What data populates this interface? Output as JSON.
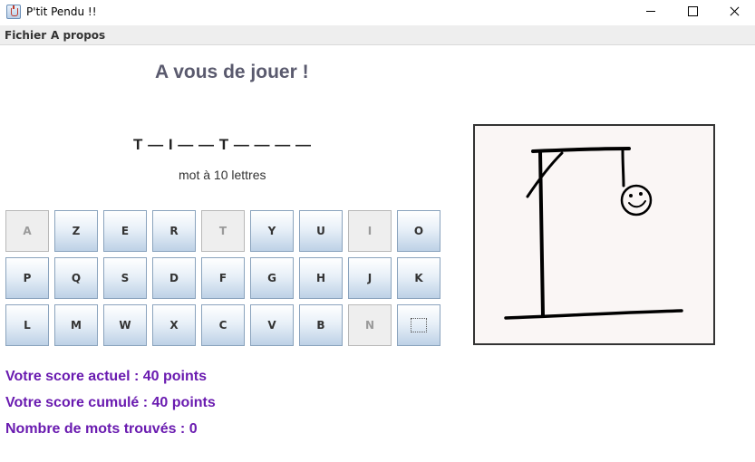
{
  "window": {
    "title": "P'tit Pendu !!",
    "icon": "java-cup-icon"
  },
  "menu": {
    "items": [
      "Fichier",
      "A propos"
    ]
  },
  "game": {
    "heading": "A vous de jouer !",
    "word_display": "T — I — — T — — — —",
    "word_info": "mot à 10 lettres"
  },
  "keyboard": {
    "rows": [
      [
        {
          "label": "A",
          "enabled": false
        },
        {
          "label": "Z",
          "enabled": true
        },
        {
          "label": "E",
          "enabled": true
        },
        {
          "label": "R",
          "enabled": true
        },
        {
          "label": "T",
          "enabled": false
        },
        {
          "label": "Y",
          "enabled": true
        },
        {
          "label": "U",
          "enabled": true
        },
        {
          "label": "I",
          "enabled": false
        },
        {
          "label": "O",
          "enabled": true
        }
      ],
      [
        {
          "label": "P",
          "enabled": true
        },
        {
          "label": "Q",
          "enabled": true
        },
        {
          "label": "S",
          "enabled": true
        },
        {
          "label": "D",
          "enabled": true
        },
        {
          "label": "F",
          "enabled": true
        },
        {
          "label": "G",
          "enabled": true
        },
        {
          "label": "H",
          "enabled": true
        },
        {
          "label": "J",
          "enabled": true
        },
        {
          "label": "K",
          "enabled": true
        }
      ],
      [
        {
          "label": "L",
          "enabled": true
        },
        {
          "label": "M",
          "enabled": true
        },
        {
          "label": "W",
          "enabled": true
        },
        {
          "label": "X",
          "enabled": true
        },
        {
          "label": "C",
          "enabled": true
        },
        {
          "label": "V",
          "enabled": true
        },
        {
          "label": "B",
          "enabled": true
        },
        {
          "label": "N",
          "enabled": false
        },
        {
          "label": "",
          "enabled": true,
          "focused": true
        }
      ]
    ]
  },
  "scores": {
    "current": "Votre score actuel : 40 points",
    "cumulative": "Votre score cumulé : 40 points",
    "words_found": "Nombre de mots trouvés : 0"
  },
  "colors": {
    "score_text": "#6a1bb0",
    "heading": "#5a5a6e"
  }
}
